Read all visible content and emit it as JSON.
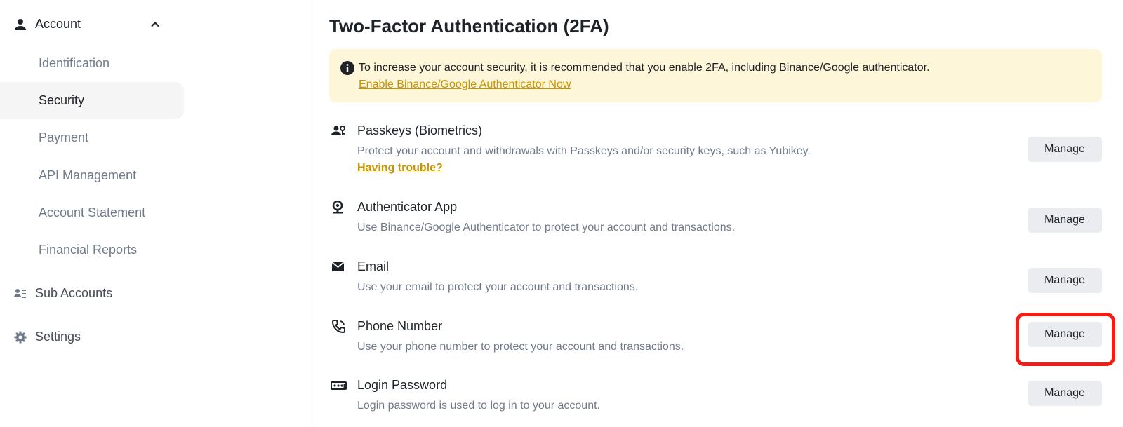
{
  "sidebar": {
    "account_label": "Account",
    "account_items": [
      {
        "label": "Identification"
      },
      {
        "label": "Security"
      },
      {
        "label": "Payment"
      },
      {
        "label": "API Management"
      },
      {
        "label": "Account Statement"
      },
      {
        "label": "Financial Reports"
      }
    ],
    "active_item": "Security",
    "sub_accounts_label": "Sub Accounts",
    "settings_label": "Settings"
  },
  "main": {
    "title": "Two-Factor Authentication (2FA)",
    "notice": {
      "text": "To increase your account security, it is recommended that you enable 2FA, including Binance/Google authenticator.",
      "link": "Enable Binance/Google Authenticator Now"
    },
    "methods": [
      {
        "title": "Passkeys (Biometrics)",
        "desc": "Protect your account and withdrawals with Passkeys and/or security keys, such as Yubikey.",
        "link": "Having trouble?",
        "button": "Manage",
        "icon": "passkey-icon"
      },
      {
        "title": "Authenticator App",
        "desc": "Use Binance/Google Authenticator to protect your account and transactions.",
        "button": "Manage",
        "icon": "authenticator-icon"
      },
      {
        "title": "Email",
        "desc": "Use your email to protect your account and transactions.",
        "button": "Manage",
        "icon": "email-icon"
      },
      {
        "title": "Phone Number",
        "desc": "Use your phone number to protect your account and transactions.",
        "button": "Manage",
        "icon": "phone-icon"
      },
      {
        "title": "Login Password",
        "desc": "Login password is used to log in to your account.",
        "button": "Manage",
        "icon": "password-icon"
      }
    ]
  },
  "colors": {
    "accent_link": "#c99400",
    "notice_bg": "#fef6d8",
    "highlight": "#f01e14",
    "button_bg": "#eaecef"
  }
}
